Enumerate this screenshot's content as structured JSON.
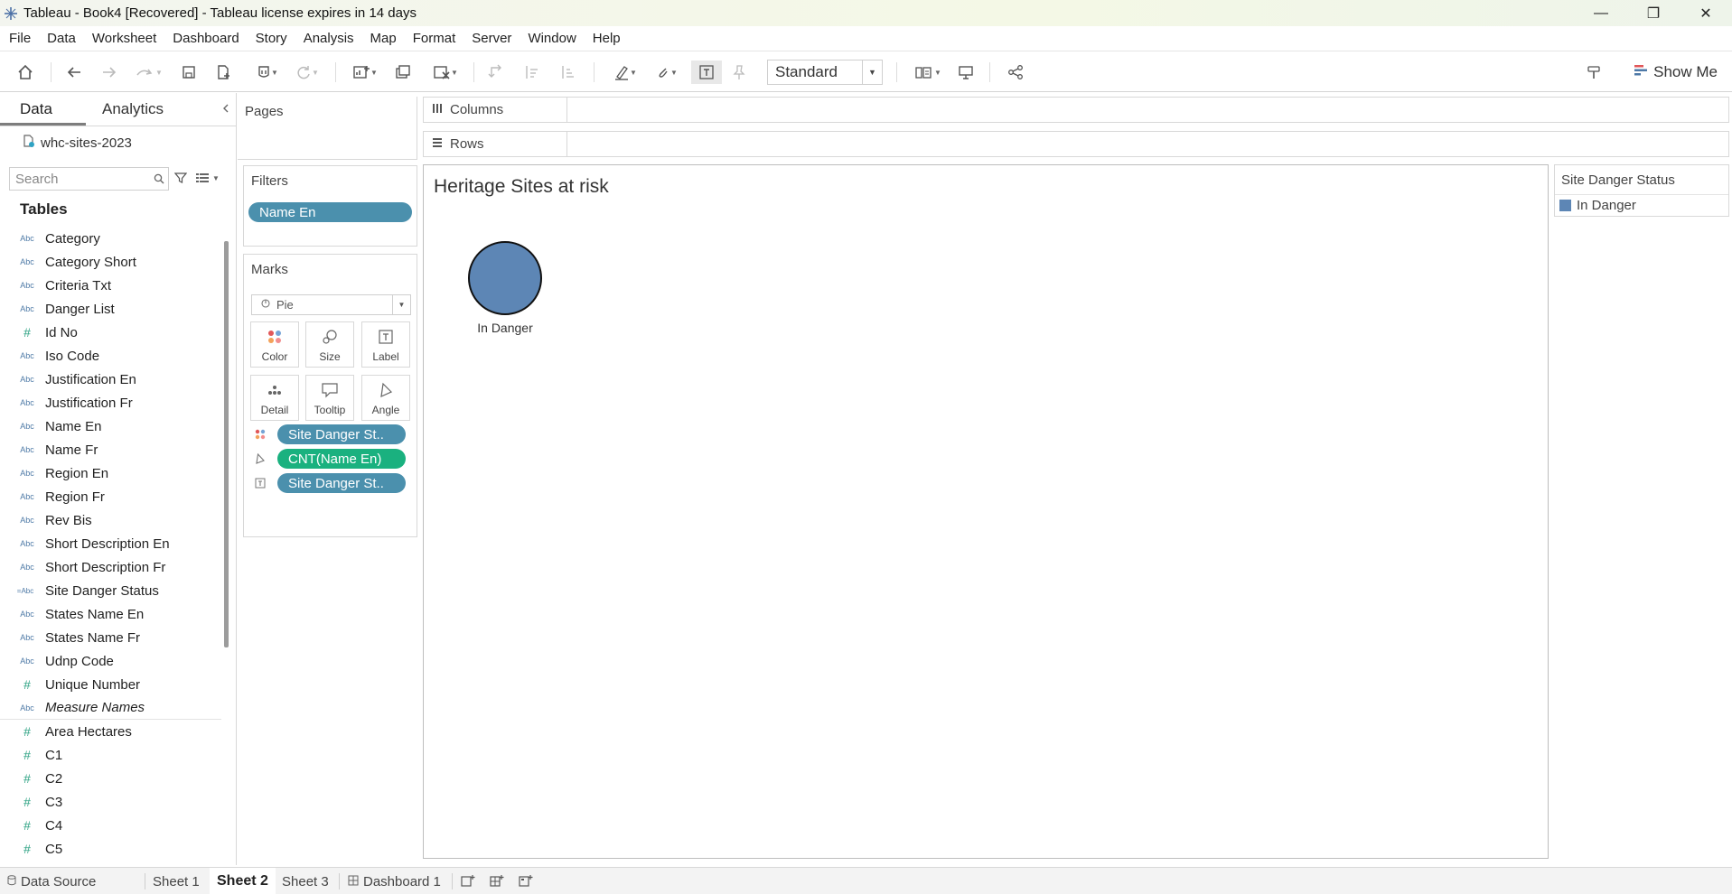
{
  "window": {
    "title": "Tableau - Book4 [Recovered] - Tableau license expires in 14 days",
    "minimize_glyph": "—",
    "restore_glyph": "❐",
    "close_glyph": "✕"
  },
  "menu": [
    "File",
    "Data",
    "Worksheet",
    "Dashboard",
    "Story",
    "Analysis",
    "Map",
    "Format",
    "Server",
    "Window",
    "Help"
  ],
  "toolbar": {
    "fit_value": "Standard",
    "show_me_label": "Show Me"
  },
  "data_pane": {
    "tab_data": "Data",
    "tab_analytics": "Analytics",
    "datasource_name": "whc-sites-2023",
    "search_placeholder": "Search",
    "tables_header": "Tables",
    "fields": [
      {
        "name": "Category",
        "type": "Abc"
      },
      {
        "name": "Category Short",
        "type": "Abc"
      },
      {
        "name": "Criteria Txt",
        "type": "Abc"
      },
      {
        "name": "Danger List",
        "type": "Abc"
      },
      {
        "name": "Id No",
        "type": "#"
      },
      {
        "name": "Iso Code",
        "type": "Abc"
      },
      {
        "name": "Justification En",
        "type": "Abc"
      },
      {
        "name": "Justification Fr",
        "type": "Abc"
      },
      {
        "name": "Name En",
        "type": "Abc"
      },
      {
        "name": "Name Fr",
        "type": "Abc"
      },
      {
        "name": "Region En",
        "type": "Abc"
      },
      {
        "name": "Region Fr",
        "type": "Abc"
      },
      {
        "name": "Rev Bis",
        "type": "Abc"
      },
      {
        "name": "Short Description En",
        "type": "Abc"
      },
      {
        "name": "Short Description Fr",
        "type": "Abc"
      },
      {
        "name": "Site Danger Status",
        "type": "=Abc"
      },
      {
        "name": "States Name En",
        "type": "Abc"
      },
      {
        "name": "States Name Fr",
        "type": "Abc"
      },
      {
        "name": "Udnp Code",
        "type": "Abc"
      },
      {
        "name": "Unique Number",
        "type": "#"
      },
      {
        "name": "Measure Names",
        "type": "Abc"
      },
      {
        "name": "Area Hectares",
        "type": "#"
      },
      {
        "name": "C1",
        "type": "#"
      },
      {
        "name": "C2",
        "type": "#"
      },
      {
        "name": "C3",
        "type": "#"
      },
      {
        "name": "C4",
        "type": "#"
      },
      {
        "name": "C5",
        "type": "#"
      }
    ]
  },
  "shelves": {
    "pages_label": "Pages",
    "filters_label": "Filters",
    "filter_pill": "Name En",
    "marks_label": "Marks",
    "mark_type": "Pie",
    "mark_buttons": [
      "Color",
      "Size",
      "Label",
      "Detail",
      "Tooltip",
      "Angle"
    ],
    "mark_pills": [
      {
        "text": "Site Danger St..",
        "color": "#4b90ad"
      },
      {
        "text": "CNT(Name En)",
        "color": "#1ab17f"
      },
      {
        "text": "Site Danger St..",
        "color": "#4b90ad"
      }
    ],
    "columns_label": "Columns",
    "rows_label": "Rows"
  },
  "view": {
    "title": "Heritage Sites at risk",
    "mark_label": "In Danger",
    "mark_color": "#5d86b5"
  },
  "chart_data": {
    "type": "pie",
    "categories": [
      "In Danger"
    ],
    "values": [
      1.0
    ]
  },
  "legend": {
    "title": "Site Danger Status",
    "item": "In Danger",
    "color": "#5d86b5"
  },
  "sheet_tabs": {
    "data_source": "Data Source",
    "tabs": [
      "Sheet 1",
      "Sheet 2",
      "Sheet 3",
      "Dashboard 1"
    ],
    "active": "Sheet 2"
  }
}
